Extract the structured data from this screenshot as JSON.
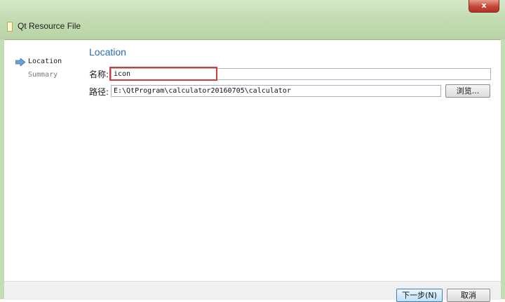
{
  "window": {
    "title": "Qt Resource File",
    "close_glyph": "x"
  },
  "steps": [
    {
      "label": "Location",
      "active": true,
      "icon": "arrow-right-icon"
    },
    {
      "label": "Summary",
      "active": false
    }
  ],
  "page": {
    "title": "Location",
    "name_label": "名称:",
    "name_value": "icon",
    "path_label": "路径:",
    "path_value": "E:\\QtProgram\\calculator20160705\\calculator",
    "browse_label": "浏览..."
  },
  "footer": {
    "next_label": "下一步(N)",
    "cancel_label": "取消"
  },
  "colors": {
    "title_bar": "#c4dcb3",
    "accent": "#2a6db5",
    "highlight": "#d63b3b",
    "close": "#c34637"
  }
}
